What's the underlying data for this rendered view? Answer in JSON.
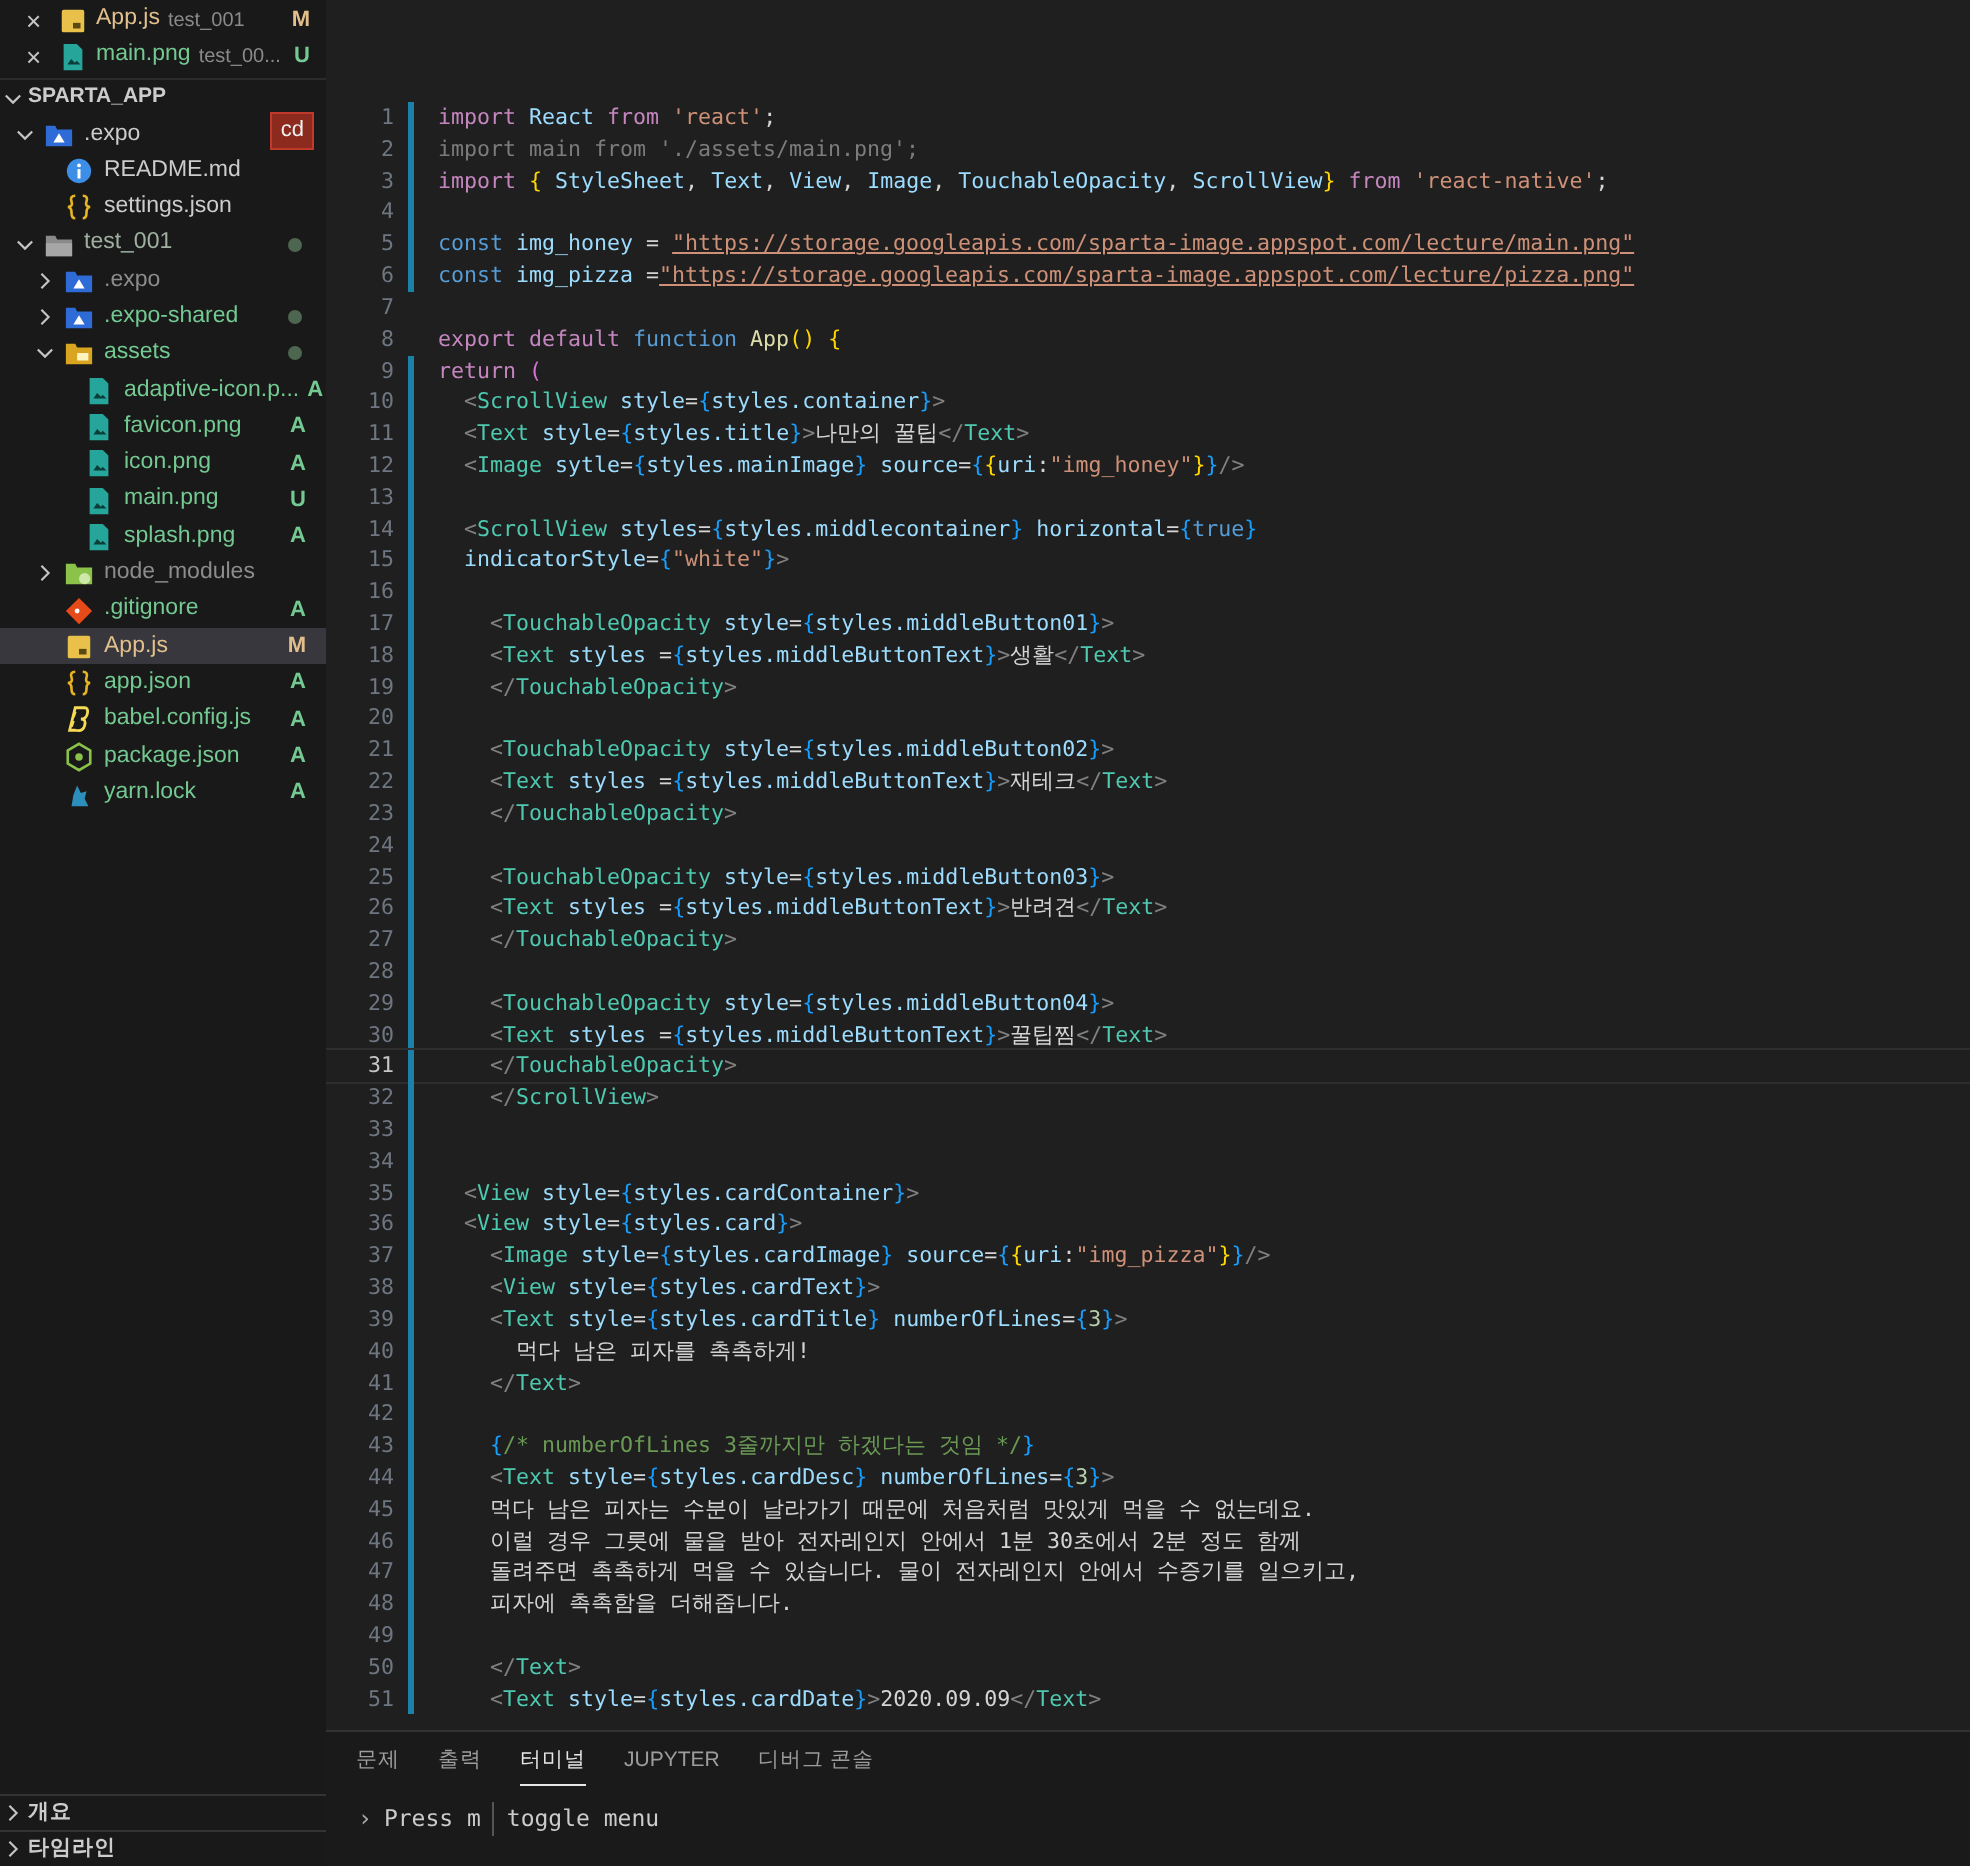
{
  "open_editors": [
    {
      "name": "App.js",
      "folder": "test_001",
      "status": "M",
      "kind": "js",
      "color": "#e2c08d",
      "close": "×"
    },
    {
      "name": "main.png",
      "folder": "test_00...",
      "status": "U",
      "kind": "image",
      "color": "#73c991",
      "close": "×"
    }
  ],
  "explorer": {
    "title": "SPARTA_APP",
    "expanded": true,
    "items": [
      {
        "name": ".expo",
        "kind": "folder-expo",
        "expanded": true,
        "color": "#cccccc",
        "badge": "cd",
        "selected": false,
        "children": [
          {
            "name": "README.md",
            "kind": "info",
            "color": "#cccccc",
            "selected": false
          },
          {
            "name": "settings.json",
            "kind": "braces",
            "color": "#cccccc",
            "selected": false
          }
        ]
      },
      {
        "name": "test_001",
        "kind": "folder",
        "expanded": true,
        "color": "#a0b0a0",
        "dot": true,
        "selected": false,
        "children": [
          {
            "name": ".expo",
            "kind": "folder-expo",
            "expanded": false,
            "color": "#8c8c8c",
            "selected": false
          },
          {
            "name": ".expo-shared",
            "kind": "folder-expo",
            "expanded": false,
            "color": "#73c991",
            "dot": true,
            "selected": false
          },
          {
            "name": "assets",
            "kind": "folder-assets",
            "expanded": true,
            "color": "#73c991",
            "dot": true,
            "selected": false,
            "children": [
              {
                "name": "adaptive-icon.p...",
                "kind": "image",
                "color": "#73c991",
                "status": "A",
                "selected": false
              },
              {
                "name": "favicon.png",
                "kind": "image",
                "color": "#73c991",
                "status": "A",
                "selected": false
              },
              {
                "name": "icon.png",
                "kind": "image",
                "color": "#73c991",
                "status": "A",
                "selected": false
              },
              {
                "name": "main.png",
                "kind": "image",
                "color": "#73c991",
                "status": "U",
                "selected": false
              },
              {
                "name": "splash.png",
                "kind": "image",
                "color": "#73c991",
                "status": "A",
                "selected": false
              }
            ]
          },
          {
            "name": "node_modules",
            "kind": "folder-node",
            "expanded": false,
            "color": "#8c8c8c",
            "selected": false
          },
          {
            "name": ".gitignore",
            "kind": "git",
            "color": "#73c991",
            "status": "A",
            "selected": false
          },
          {
            "name": "App.js",
            "kind": "js",
            "color": "#e2c08d",
            "status": "M",
            "selected": true
          },
          {
            "name": "app.json",
            "kind": "braces",
            "color": "#73c991",
            "status": "A",
            "selected": false
          },
          {
            "name": "babel.config.js",
            "kind": "babel",
            "color": "#73c991",
            "status": "A",
            "selected": false
          },
          {
            "name": "package.json",
            "kind": "node",
            "color": "#73c991",
            "status": "A",
            "selected": false
          },
          {
            "name": "yarn.lock",
            "kind": "yarn",
            "color": "#73c991",
            "status": "A",
            "selected": false
          }
        ]
      }
    ]
  },
  "sidebar_sections": [
    {
      "title": "개요",
      "expanded": false
    },
    {
      "title": "타임라인",
      "expanded": false
    }
  ],
  "editor": {
    "lines": [
      {
        "n": "1",
        "modified": true,
        "current": false,
        "tokens": [
          {
            "kind": "keyword",
            "text": "import "
          },
          {
            "kind": "variable",
            "text": "React "
          },
          {
            "kind": "keyword",
            "text": "from "
          },
          {
            "kind": "string",
            "text": "'react'"
          },
          {
            "kind": "plain",
            "text": ";"
          }
        ]
      },
      {
        "n": "2",
        "modified": true,
        "current": false,
        "tokens": [
          {
            "kind": "faded",
            "text": "import main from './assets/main.png';"
          }
        ]
      },
      {
        "n": "3",
        "modified": true,
        "current": false,
        "tokens": [
          {
            "kind": "keyword",
            "text": "import "
          },
          {
            "kind": "bracket",
            "text": "{ "
          },
          {
            "kind": "variable",
            "text": "StyleSheet"
          },
          {
            "kind": "plain",
            "text": ", "
          },
          {
            "kind": "variable",
            "text": "Text"
          },
          {
            "kind": "plain",
            "text": ", "
          },
          {
            "kind": "variable",
            "text": "View"
          },
          {
            "kind": "plain",
            "text": ", "
          },
          {
            "kind": "variable",
            "text": "Image"
          },
          {
            "kind": "plain",
            "text": ", "
          },
          {
            "kind": "variable",
            "text": "TouchableOpacity"
          },
          {
            "kind": "plain",
            "text": ", "
          },
          {
            "kind": "variable",
            "text": "ScrollView"
          },
          {
            "kind": "bracket",
            "text": "}"
          },
          {
            "kind": "keyword",
            "text": " from "
          },
          {
            "kind": "string",
            "text": "'react-native'"
          },
          {
            "kind": "plain",
            "text": ";"
          }
        ]
      },
      {
        "n": "4",
        "modified": true,
        "current": false
      },
      {
        "n": "5",
        "modified": true,
        "current": false,
        "tokens": [
          {
            "kind": "storage",
            "text": "const "
          },
          {
            "kind": "variable",
            "text": "img_honey"
          },
          {
            "kind": "plain",
            "text": " = "
          },
          {
            "kind": "link",
            "text": "\"https://storage.googleapis.com/sparta-image.appspot.com/lecture/main.png\""
          }
        ]
      },
      {
        "n": "6",
        "modified": true,
        "current": false,
        "tokens": [
          {
            "kind": "storage",
            "text": "const "
          },
          {
            "kind": "variable",
            "text": "img_pizza"
          },
          {
            "kind": "plain",
            "text": " ="
          },
          {
            "kind": "link",
            "text": "\"https://storage.googleapis.com/sparta-image.appspot.com/lecture/pizza.png\""
          }
        ]
      },
      {
        "n": "7",
        "modified": false,
        "current": false
      },
      {
        "n": "8",
        "modified": false,
        "current": false,
        "tokens": [
          {
            "kind": "keyword",
            "text": "export "
          },
          {
            "kind": "keyword",
            "text": "default "
          },
          {
            "kind": "storage",
            "text": "function "
          },
          {
            "kind": "function",
            "text": "App"
          },
          {
            "kind": "bracket",
            "text": "() {"
          }
        ]
      },
      {
        "n": "9",
        "modified": true,
        "current": false,
        "tokens": [
          {
            "kind": "keyword",
            "text": "return "
          },
          {
            "kind": "paren",
            "text": "("
          }
        ]
      },
      {
        "n": "10",
        "modified": true,
        "current": false,
        "tokens": [
          {
            "kind": "punctuation",
            "text": "  <"
          },
          {
            "kind": "tag",
            "text": "ScrollView"
          },
          {
            "kind": "variable",
            "text": " style"
          },
          {
            "kind": "plain",
            "text": "="
          },
          {
            "kind": "brace",
            "text": "{"
          },
          {
            "kind": "variable",
            "text": "styles.container"
          },
          {
            "kind": "brace",
            "text": "}"
          },
          {
            "kind": "punctuation",
            "text": ">"
          }
        ]
      },
      {
        "n": "11",
        "modified": true,
        "current": false,
        "tokens": [
          {
            "kind": "punctuation",
            "text": "  <"
          },
          {
            "kind": "tag",
            "text": "Text"
          },
          {
            "kind": "variable",
            "text": " style"
          },
          {
            "kind": "plain",
            "text": "="
          },
          {
            "kind": "brace",
            "text": "{"
          },
          {
            "kind": "variable",
            "text": "styles.title"
          },
          {
            "kind": "brace",
            "text": "}"
          },
          {
            "kind": "punctuation",
            "text": ">"
          },
          {
            "kind": "plain",
            "text": "나만의 꿀팁"
          },
          {
            "kind": "punctuation",
            "text": "</"
          },
          {
            "kind": "tag",
            "text": "Text"
          },
          {
            "kind": "punctuation",
            "text": ">"
          }
        ]
      },
      {
        "n": "12",
        "modified": true,
        "current": false,
        "tokens": [
          {
            "kind": "punctuation",
            "text": "  <"
          },
          {
            "kind": "tag",
            "text": "Image"
          },
          {
            "kind": "variable",
            "text": " sytle"
          },
          {
            "kind": "plain",
            "text": "="
          },
          {
            "kind": "brace",
            "text": "{"
          },
          {
            "kind": "variable",
            "text": "styles.mainImage"
          },
          {
            "kind": "brace",
            "text": "}"
          },
          {
            "kind": "variable",
            "text": " source"
          },
          {
            "kind": "plain",
            "text": "="
          },
          {
            "kind": "brace",
            "text": "{"
          },
          {
            "kind": "bracket",
            "text": "{"
          },
          {
            "kind": "variable",
            "text": "uri"
          },
          {
            "kind": "plain",
            "text": ":"
          },
          {
            "kind": "string",
            "text": "\"img_honey\""
          },
          {
            "kind": "bracket",
            "text": "}"
          },
          {
            "kind": "brace",
            "text": "}"
          },
          {
            "kind": "punctuation",
            "text": "/>"
          }
        ]
      },
      {
        "n": "13",
        "modified": true,
        "current": false
      },
      {
        "n": "14",
        "modified": true,
        "current": false,
        "tokens": [
          {
            "kind": "punctuation",
            "text": "  <"
          },
          {
            "kind": "tag",
            "text": "ScrollView"
          },
          {
            "kind": "variable",
            "text": " styles"
          },
          {
            "kind": "plain",
            "text": "="
          },
          {
            "kind": "brace",
            "text": "{"
          },
          {
            "kind": "variable",
            "text": "styles.middlecontainer"
          },
          {
            "kind": "brace",
            "text": "}"
          },
          {
            "kind": "variable",
            "text": " horizontal"
          },
          {
            "kind": "plain",
            "text": "="
          },
          {
            "kind": "brace",
            "text": "{"
          },
          {
            "kind": "storage",
            "text": "true"
          },
          {
            "kind": "brace",
            "text": "}"
          }
        ]
      },
      {
        "n": "15",
        "modified": true,
        "current": false,
        "tokens": [
          {
            "kind": "variable",
            "text": "  indicatorStyle"
          },
          {
            "kind": "plain",
            "text": "="
          },
          {
            "kind": "brace",
            "text": "{"
          },
          {
            "kind": "string",
            "text": "\"white\""
          },
          {
            "kind": "brace",
            "text": "}"
          },
          {
            "kind": "punctuation",
            "text": ">"
          }
        ]
      },
      {
        "n": "16",
        "modified": true,
        "current": false
      },
      {
        "n": "17",
        "modified": true,
        "current": false,
        "tokens": [
          {
            "kind": "punctuation",
            "text": "    <"
          },
          {
            "kind": "tag",
            "text": "TouchableOpacity"
          },
          {
            "kind": "variable",
            "text": " style"
          },
          {
            "kind": "plain",
            "text": "="
          },
          {
            "kind": "brace",
            "text": "{"
          },
          {
            "kind": "variable",
            "text": "styles.middleButton01"
          },
          {
            "kind": "brace",
            "text": "}"
          },
          {
            "kind": "punctuation",
            "text": ">"
          }
        ]
      },
      {
        "n": "18",
        "modified": true,
        "current": false,
        "tokens": [
          {
            "kind": "punctuation",
            "text": "    <"
          },
          {
            "kind": "tag",
            "text": "Text"
          },
          {
            "kind": "variable",
            "text": " styles "
          },
          {
            "kind": "plain",
            "text": "="
          },
          {
            "kind": "brace",
            "text": "{"
          },
          {
            "kind": "variable",
            "text": "styles.middleButtonText"
          },
          {
            "kind": "brace",
            "text": "}"
          },
          {
            "kind": "punctuation",
            "text": ">"
          },
          {
            "kind": "plain",
            "text": "생활"
          },
          {
            "kind": "punctuation",
            "text": "</"
          },
          {
            "kind": "tag",
            "text": "Text"
          },
          {
            "kind": "punctuation",
            "text": ">"
          }
        ]
      },
      {
        "n": "19",
        "modified": true,
        "current": false,
        "tokens": [
          {
            "kind": "punctuation",
            "text": "    </"
          },
          {
            "kind": "tag",
            "text": "TouchableOpacity"
          },
          {
            "kind": "punctuation",
            "text": ">"
          }
        ]
      },
      {
        "n": "20",
        "modified": true,
        "current": false
      },
      {
        "n": "21",
        "modified": true,
        "current": false,
        "tokens": [
          {
            "kind": "punctuation",
            "text": "    <"
          },
          {
            "kind": "tag",
            "text": "TouchableOpacity"
          },
          {
            "kind": "variable",
            "text": " style"
          },
          {
            "kind": "plain",
            "text": "="
          },
          {
            "kind": "brace",
            "text": "{"
          },
          {
            "kind": "variable",
            "text": "styles.middleButton02"
          },
          {
            "kind": "brace",
            "text": "}"
          },
          {
            "kind": "punctuation",
            "text": ">"
          }
        ]
      },
      {
        "n": "22",
        "modified": true,
        "current": false,
        "tokens": [
          {
            "kind": "punctuation",
            "text": "    <"
          },
          {
            "kind": "tag",
            "text": "Text"
          },
          {
            "kind": "variable",
            "text": " styles "
          },
          {
            "kind": "plain",
            "text": "="
          },
          {
            "kind": "brace",
            "text": "{"
          },
          {
            "kind": "variable",
            "text": "styles.middleButtonText"
          },
          {
            "kind": "brace",
            "text": "}"
          },
          {
            "kind": "punctuation",
            "text": ">"
          },
          {
            "kind": "plain",
            "text": "재테크"
          },
          {
            "kind": "punctuation",
            "text": "</"
          },
          {
            "kind": "tag",
            "text": "Text"
          },
          {
            "kind": "punctuation",
            "text": ">"
          }
        ]
      },
      {
        "n": "23",
        "modified": true,
        "current": false,
        "tokens": [
          {
            "kind": "punctuation",
            "text": "    </"
          },
          {
            "kind": "tag",
            "text": "TouchableOpacity"
          },
          {
            "kind": "punctuation",
            "text": ">"
          }
        ]
      },
      {
        "n": "24",
        "modified": true,
        "current": false
      },
      {
        "n": "25",
        "modified": true,
        "current": false,
        "tokens": [
          {
            "kind": "punctuation",
            "text": "    <"
          },
          {
            "kind": "tag",
            "text": "TouchableOpacity"
          },
          {
            "kind": "variable",
            "text": " style"
          },
          {
            "kind": "plain",
            "text": "="
          },
          {
            "kind": "brace",
            "text": "{"
          },
          {
            "kind": "variable",
            "text": "styles.middleButton03"
          },
          {
            "kind": "brace",
            "text": "}"
          },
          {
            "kind": "punctuation",
            "text": ">"
          }
        ]
      },
      {
        "n": "26",
        "modified": true,
        "current": false,
        "tokens": [
          {
            "kind": "punctuation",
            "text": "    <"
          },
          {
            "kind": "tag",
            "text": "Text"
          },
          {
            "kind": "variable",
            "text": " styles "
          },
          {
            "kind": "plain",
            "text": "="
          },
          {
            "kind": "brace",
            "text": "{"
          },
          {
            "kind": "variable",
            "text": "styles.middleButtonText"
          },
          {
            "kind": "brace",
            "text": "}"
          },
          {
            "kind": "punctuation",
            "text": ">"
          },
          {
            "kind": "plain",
            "text": "반려견"
          },
          {
            "kind": "punctuation",
            "text": "</"
          },
          {
            "kind": "tag",
            "text": "Text"
          },
          {
            "kind": "punctuation",
            "text": ">"
          }
        ]
      },
      {
        "n": "27",
        "modified": true,
        "current": false,
        "tokens": [
          {
            "kind": "punctuation",
            "text": "    </"
          },
          {
            "kind": "tag",
            "text": "TouchableOpacity"
          },
          {
            "kind": "punctuation",
            "text": ">"
          }
        ]
      },
      {
        "n": "28",
        "modified": true,
        "current": false
      },
      {
        "n": "29",
        "modified": true,
        "current": false,
        "tokens": [
          {
            "kind": "punctuation",
            "text": "    <"
          },
          {
            "kind": "tag",
            "text": "TouchableOpacity"
          },
          {
            "kind": "variable",
            "text": " style"
          },
          {
            "kind": "plain",
            "text": "="
          },
          {
            "kind": "brace",
            "text": "{"
          },
          {
            "kind": "variable",
            "text": "styles.middleButton04"
          },
          {
            "kind": "brace",
            "text": "}"
          },
          {
            "kind": "punctuation",
            "text": ">"
          }
        ]
      },
      {
        "n": "30",
        "modified": true,
        "current": false,
        "tokens": [
          {
            "kind": "punctuation",
            "text": "    <"
          },
          {
            "kind": "tag",
            "text": "Text"
          },
          {
            "kind": "variable",
            "text": " styles "
          },
          {
            "kind": "plain",
            "text": "="
          },
          {
            "kind": "brace",
            "text": "{"
          },
          {
            "kind": "variable",
            "text": "styles.middleButtonText"
          },
          {
            "kind": "brace",
            "text": "}"
          },
          {
            "kind": "punctuation",
            "text": ">"
          },
          {
            "kind": "plain",
            "text": "꿀팁찜"
          },
          {
            "kind": "punctuation",
            "text": "</"
          },
          {
            "kind": "tag",
            "text": "Text"
          },
          {
            "kind": "punctuation",
            "text": ">"
          }
        ]
      },
      {
        "n": "31",
        "modified": true,
        "current": true,
        "tokens": [
          {
            "kind": "punctuation",
            "text": "    </"
          },
          {
            "kind": "tag",
            "text": "TouchableOpacity"
          },
          {
            "kind": "punctuation",
            "text": ">"
          }
        ]
      },
      {
        "n": "32",
        "modified": true,
        "current": false,
        "tokens": [
          {
            "kind": "punctuation",
            "text": "    </"
          },
          {
            "kind": "tag",
            "text": "ScrollView"
          },
          {
            "kind": "punctuation",
            "text": ">"
          }
        ]
      },
      {
        "n": "33",
        "modified": true,
        "current": false
      },
      {
        "n": "34",
        "modified": true,
        "current": false
      },
      {
        "n": "35",
        "modified": true,
        "current": false,
        "tokens": [
          {
            "kind": "punctuation",
            "text": "  <"
          },
          {
            "kind": "tag",
            "text": "View"
          },
          {
            "kind": "variable",
            "text": " style"
          },
          {
            "kind": "plain",
            "text": "="
          },
          {
            "kind": "brace",
            "text": "{"
          },
          {
            "kind": "variable",
            "text": "styles.cardContainer"
          },
          {
            "kind": "brace",
            "text": "}"
          },
          {
            "kind": "punctuation",
            "text": ">"
          }
        ]
      },
      {
        "n": "36",
        "modified": true,
        "current": false,
        "tokens": [
          {
            "kind": "punctuation",
            "text": "  <"
          },
          {
            "kind": "tag",
            "text": "View"
          },
          {
            "kind": "variable",
            "text": " style"
          },
          {
            "kind": "plain",
            "text": "="
          },
          {
            "kind": "brace",
            "text": "{"
          },
          {
            "kind": "variable",
            "text": "styles.card"
          },
          {
            "kind": "brace",
            "text": "}"
          },
          {
            "kind": "punctuation",
            "text": ">"
          }
        ]
      },
      {
        "n": "37",
        "modified": true,
        "current": false,
        "tokens": [
          {
            "kind": "punctuation",
            "text": "    <"
          },
          {
            "kind": "tag",
            "text": "Image"
          },
          {
            "kind": "variable",
            "text": " style"
          },
          {
            "kind": "plain",
            "text": "="
          },
          {
            "kind": "brace",
            "text": "{"
          },
          {
            "kind": "variable",
            "text": "styles.cardImage"
          },
          {
            "kind": "brace",
            "text": "}"
          },
          {
            "kind": "variable",
            "text": " source"
          },
          {
            "kind": "plain",
            "text": "="
          },
          {
            "kind": "brace",
            "text": "{"
          },
          {
            "kind": "bracket",
            "text": "{"
          },
          {
            "kind": "variable",
            "text": "uri"
          },
          {
            "kind": "plain",
            "text": ":"
          },
          {
            "kind": "string",
            "text": "\"img_pizza\""
          },
          {
            "kind": "bracket",
            "text": "}"
          },
          {
            "kind": "brace",
            "text": "}"
          },
          {
            "kind": "punctuation",
            "text": "/>"
          }
        ]
      },
      {
        "n": "38",
        "modified": true,
        "current": false,
        "tokens": [
          {
            "kind": "punctuation",
            "text": "    <"
          },
          {
            "kind": "tag",
            "text": "View"
          },
          {
            "kind": "variable",
            "text": " style"
          },
          {
            "kind": "plain",
            "text": "="
          },
          {
            "kind": "brace",
            "text": "{"
          },
          {
            "kind": "variable",
            "text": "styles.cardText"
          },
          {
            "kind": "brace",
            "text": "}"
          },
          {
            "kind": "punctuation",
            "text": ">"
          }
        ]
      },
      {
        "n": "39",
        "modified": true,
        "current": false,
        "tokens": [
          {
            "kind": "punctuation",
            "text": "    <"
          },
          {
            "kind": "tag",
            "text": "Text"
          },
          {
            "kind": "variable",
            "text": " style"
          },
          {
            "kind": "plain",
            "text": "="
          },
          {
            "kind": "brace",
            "text": "{"
          },
          {
            "kind": "variable",
            "text": "styles.cardTitle"
          },
          {
            "kind": "brace",
            "text": "}"
          },
          {
            "kind": "variable",
            "text": " numberOfLines"
          },
          {
            "kind": "plain",
            "text": "="
          },
          {
            "kind": "brace",
            "text": "{"
          },
          {
            "kind": "number",
            "text": "3"
          },
          {
            "kind": "brace",
            "text": "}"
          },
          {
            "kind": "punctuation",
            "text": ">"
          }
        ]
      },
      {
        "n": "40",
        "modified": true,
        "current": false,
        "tokens": [
          {
            "kind": "plain",
            "text": "      먹다 남은 피자를 촉촉하게!"
          }
        ]
      },
      {
        "n": "41",
        "modified": true,
        "current": false,
        "tokens": [
          {
            "kind": "punctuation",
            "text": "    </"
          },
          {
            "kind": "tag",
            "text": "Text"
          },
          {
            "kind": "punctuation",
            "text": ">"
          }
        ]
      },
      {
        "n": "42",
        "modified": true,
        "current": false
      },
      {
        "n": "43",
        "modified": true,
        "current": false,
        "tokens": [
          {
            "kind": "brace",
            "text": "    {"
          },
          {
            "kind": "comment",
            "text": "/* numberOfLines 3줄까지만 하겠다는 것임 */"
          },
          {
            "kind": "brace",
            "text": "}"
          }
        ]
      },
      {
        "n": "44",
        "modified": true,
        "current": false,
        "tokens": [
          {
            "kind": "punctuation",
            "text": "    <"
          },
          {
            "kind": "tag",
            "text": "Text"
          },
          {
            "kind": "variable",
            "text": " style"
          },
          {
            "kind": "plain",
            "text": "="
          },
          {
            "kind": "brace",
            "text": "{"
          },
          {
            "kind": "variable",
            "text": "styles.cardDesc"
          },
          {
            "kind": "brace",
            "text": "}"
          },
          {
            "kind": "variable",
            "text": " numberOfLines"
          },
          {
            "kind": "plain",
            "text": "="
          },
          {
            "kind": "brace",
            "text": "{"
          },
          {
            "kind": "number",
            "text": "3"
          },
          {
            "kind": "brace",
            "text": "}"
          },
          {
            "kind": "punctuation",
            "text": ">"
          }
        ]
      },
      {
        "n": "45",
        "modified": true,
        "current": false,
        "tokens": [
          {
            "kind": "plain",
            "text": "    먹다 남은 피자는 수분이 날라가기 때문에 처음처럼 맛있게 먹을 수 없는데요."
          }
        ]
      },
      {
        "n": "46",
        "modified": true,
        "current": false,
        "tokens": [
          {
            "kind": "plain",
            "text": "    이럴 경우 그릇에 물을 받아 전자레인지 안에서 1분 30초에서 2분 정도 함께"
          }
        ]
      },
      {
        "n": "47",
        "modified": true,
        "current": false,
        "tokens": [
          {
            "kind": "plain",
            "text": "    돌려주면 촉촉하게 먹을 수 있습니다. 물이 전자레인지 안에서 수증기를 일으키고,"
          }
        ]
      },
      {
        "n": "48",
        "modified": true,
        "current": false,
        "tokens": [
          {
            "kind": "plain",
            "text": "    피자에 촉촉함을 더해줍니다."
          }
        ]
      },
      {
        "n": "49",
        "modified": true,
        "current": false
      },
      {
        "n": "50",
        "modified": true,
        "current": false,
        "tokens": [
          {
            "kind": "punctuation",
            "text": "    </"
          },
          {
            "kind": "tag",
            "text": "Text"
          },
          {
            "kind": "punctuation",
            "text": ">"
          }
        ]
      },
      {
        "n": "51",
        "modified": true,
        "current": false,
        "tokens": [
          {
            "kind": "punctuation",
            "text": "    <"
          },
          {
            "kind": "tag",
            "text": "Text"
          },
          {
            "kind": "variable",
            "text": " style"
          },
          {
            "kind": "plain",
            "text": "="
          },
          {
            "kind": "brace",
            "text": "{"
          },
          {
            "kind": "variable",
            "text": "styles.cardDate"
          },
          {
            "kind": "brace",
            "text": "}"
          },
          {
            "kind": "punctuation",
            "text": ">"
          },
          {
            "kind": "plain",
            "text": "2020.09.09"
          },
          {
            "kind": "punctuation",
            "text": "</"
          },
          {
            "kind": "tag",
            "text": "Text"
          },
          {
            "kind": "punctuation",
            "text": ">"
          }
        ]
      }
    ]
  },
  "panel": {
    "tabs": [
      {
        "label": "문제",
        "selected": false
      },
      {
        "label": "출력",
        "selected": false
      },
      {
        "label": "터미널",
        "selected": true
      },
      {
        "label": "JUPYTER",
        "selected": false
      },
      {
        "label": "디버그 콘솔",
        "selected": false
      }
    ],
    "terminal": {
      "prompt": "›",
      "key": "Press m",
      "action": "toggle menu"
    }
  }
}
